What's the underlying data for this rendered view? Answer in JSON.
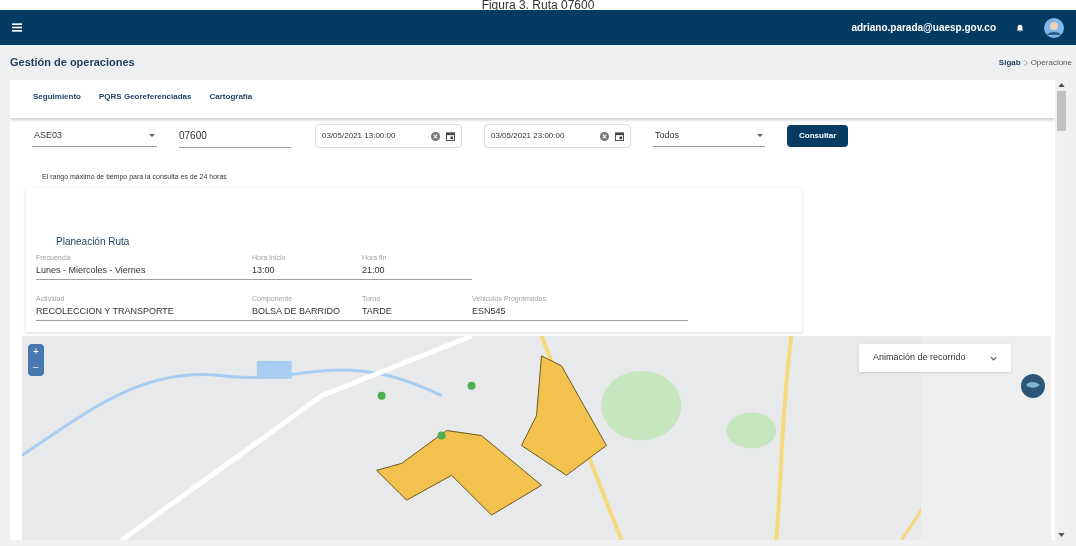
{
  "caption": "Figura 3. Ruta 07600",
  "top_bar": {
    "user_email": "adriano.parada@uaesp.gov.co"
  },
  "page_title": "Gestión de operaciones",
  "breadcrumb": [
    "Sigab",
    "Operacione"
  ],
  "tabs": [
    {
      "label": "Seguimiento",
      "selected": false
    },
    {
      "label": "PQRS Georeferenciadas",
      "selected": false
    },
    {
      "label": "Cartografía",
      "selected": false
    }
  ],
  "filters": {
    "operator": "ASE03",
    "route": "07600",
    "start": "03/05/2021 13:00:00",
    "end": "03/05/2021 23:00:00",
    "status": "Todos",
    "button": "Consultar"
  },
  "hint": "El rango máximo de tiempo para la consulta es de 24 horas",
  "plan": {
    "title": "Planeación Ruta",
    "rows": [
      [
        {
          "label": "Frecuencia",
          "value": "Lunes - Miercoles - Viernes"
        },
        {
          "label": "Hora Inicio",
          "value": "13:00"
        },
        {
          "label": "Hora fin",
          "value": "21:00"
        }
      ],
      [
        {
          "label": "Actividad",
          "value": "RECOLECCION Y TRANSPORTE"
        },
        {
          "label": "Componente",
          "value": "BOLSA DE BARRIDO"
        },
        {
          "label": "Turno",
          "value": "TARDE"
        },
        {
          "label": "Vehiculos Programados",
          "value": "ESN545"
        }
      ]
    ]
  },
  "map": {
    "zoom_in": "+",
    "zoom_out": "−",
    "animation_select": "Animación de recorrido"
  }
}
